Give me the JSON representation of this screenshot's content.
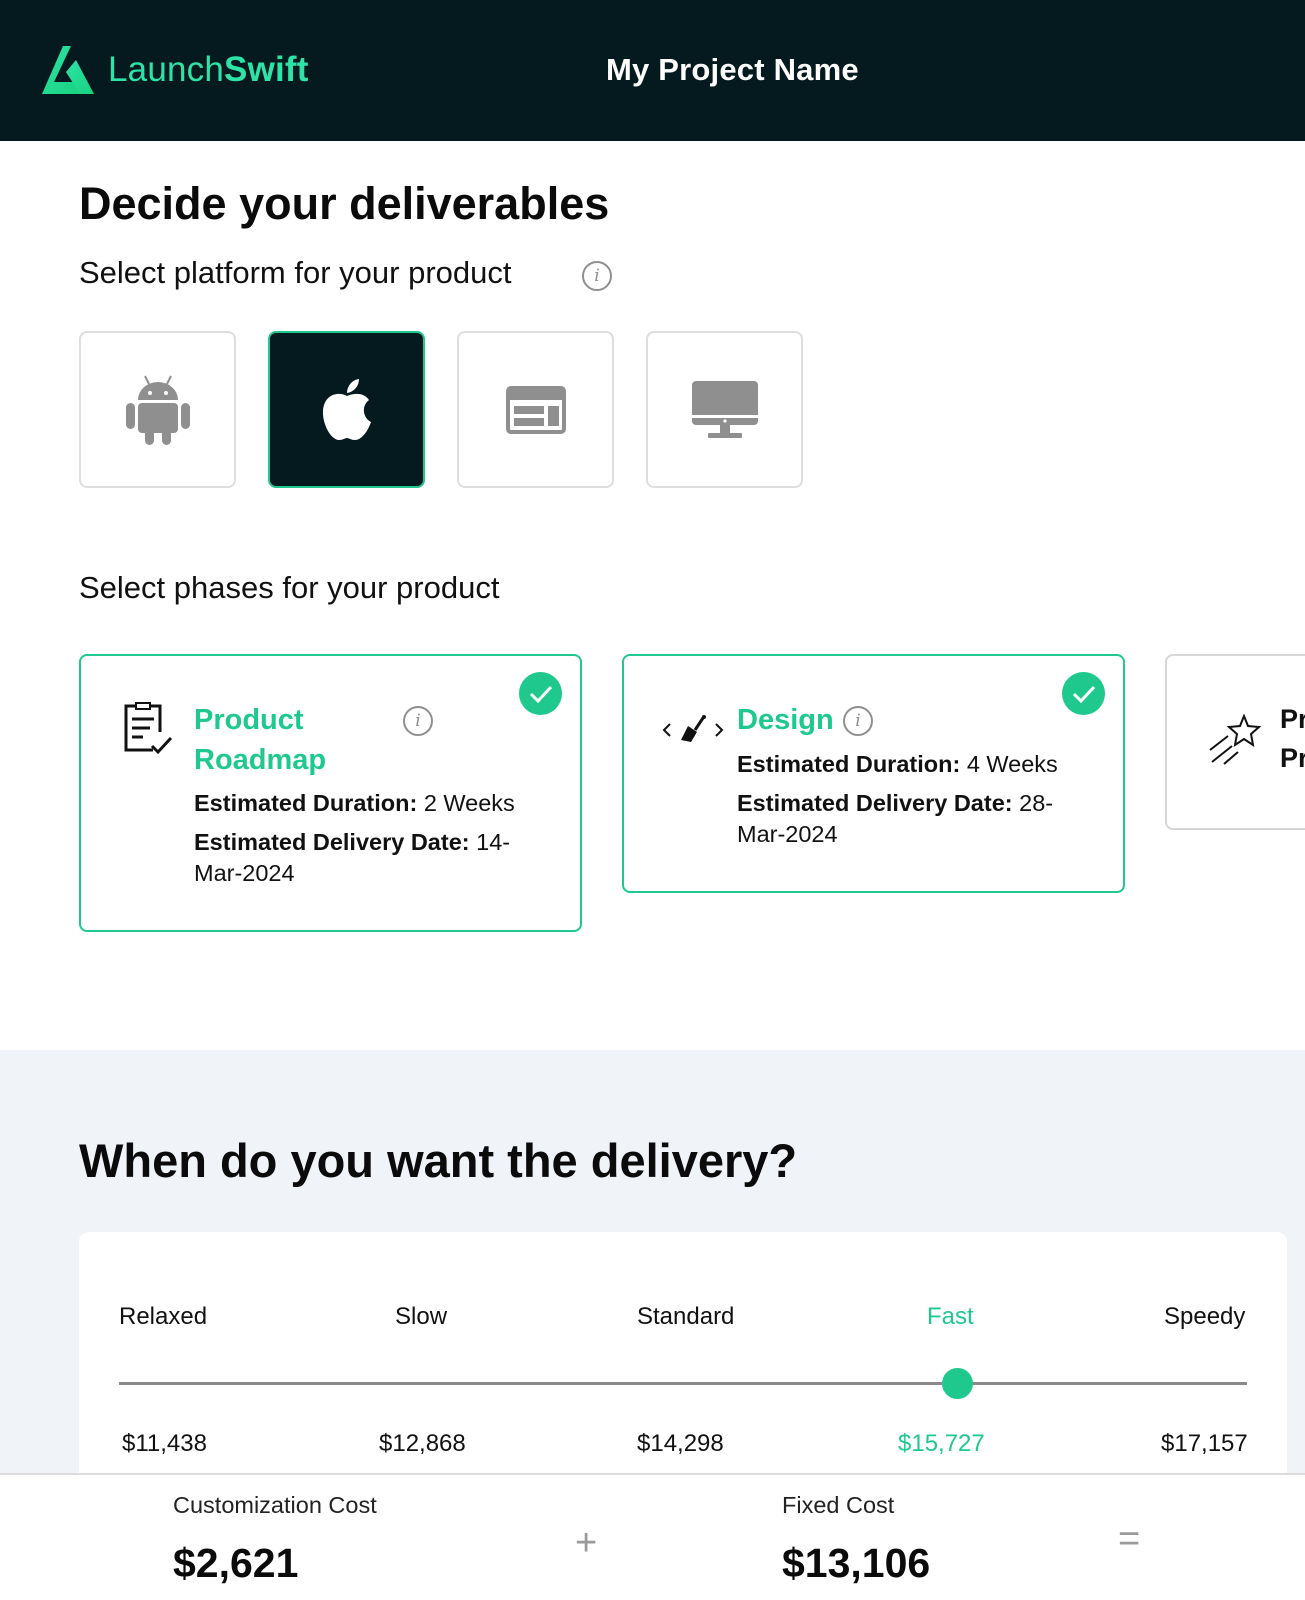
{
  "header": {
    "logo_text_1": "Launch",
    "logo_text_2": "Swift",
    "project_name": "My Project Name"
  },
  "deliverables": {
    "title": "Decide your deliverables",
    "platform_label": "Select platform for your product",
    "platforms": [
      {
        "name": "android-icon",
        "selected": false
      },
      {
        "name": "apple-icon",
        "selected": true
      },
      {
        "name": "web-icon",
        "selected": false
      },
      {
        "name": "desktop-icon",
        "selected": false
      }
    ],
    "phases_label": "Select phases for your product",
    "phases": [
      {
        "title_line1": "Product",
        "title_line2": "Roadmap",
        "duration_label": "Estimated Duration:",
        "duration_value": "2 Weeks",
        "delivery_label": "Estimated Delivery Date:",
        "delivery_value_1": "14-",
        "delivery_value_2": "Mar-2024",
        "selected": true,
        "icon": "roadmap-icon"
      },
      {
        "title_line1": "Design",
        "duration_label": "Estimated Duration:",
        "duration_value": "4 Weeks",
        "delivery_label": "Estimated Delivery Date:",
        "delivery_value_1": "28-",
        "delivery_value_2": "Mar-2024",
        "selected": true,
        "icon": "design-icon"
      },
      {
        "title_line1": "Pr",
        "title_line2": "Pr",
        "selected": false,
        "icon": "star-icon"
      }
    ]
  },
  "delivery": {
    "title": "When do you want the delivery?",
    "speeds": [
      "Relaxed",
      "Slow",
      "Standard",
      "Fast",
      "Speedy"
    ],
    "prices": [
      "$11,438",
      "$12,868",
      "$14,298",
      "$15,727",
      "$17,157"
    ],
    "selected_index": 3
  },
  "costs": {
    "customization_label": "Customization Cost",
    "customization_value": "$2,621",
    "plus": "+",
    "fixed_label": "Fixed Cost",
    "fixed_value": "$13,106",
    "equals": "="
  },
  "colors": {
    "accent": "#1fc98e",
    "header_bg": "#041a1f",
    "section_bg": "#f0f3f8"
  }
}
